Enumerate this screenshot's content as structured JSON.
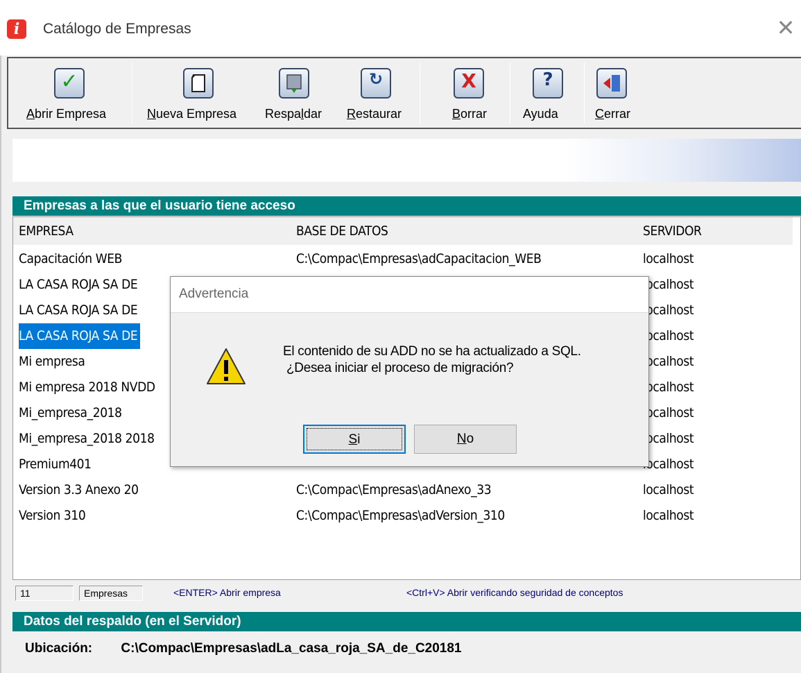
{
  "window": {
    "title": "Catálogo de Empresas",
    "close_glyph": "✕"
  },
  "toolbar": {
    "buttons": [
      {
        "key": "A",
        "rest": "brir Empresa",
        "icon": "checkmark-icon"
      },
      {
        "key": "N",
        "rest": "ueva Empresa",
        "icon": "new-document-icon"
      },
      {
        "pre": "Respa",
        "key": "l",
        "rest": "dar",
        "icon": "backup-icon"
      },
      {
        "key": "R",
        "rest": "estaurar",
        "icon": "restore-icon"
      },
      {
        "key": "B",
        "rest": "orrar",
        "icon": "delete-icon"
      },
      {
        "pre": "Ayuda",
        "icon": "help-icon"
      },
      {
        "key": "C",
        "rest": "errar",
        "icon": "exit-icon"
      }
    ]
  },
  "companies_section": {
    "header": "Empresas a las que el usuario tiene acceso"
  },
  "list": {
    "columns": [
      "EMPRESA",
      "BASE DE DATOS",
      "SERVIDOR"
    ],
    "rows": [
      {
        "empresa": "Capacitación WEB",
        "base": "C:\\Compac\\Empresas\\adCapacitacion_WEB",
        "servidor": "localhost"
      },
      {
        "empresa": "LA CASA ROJA SA DE",
        "base": "",
        "servidor": "localhost"
      },
      {
        "empresa": "LA CASA ROJA SA DE",
        "base": "",
        "servidor": "localhost"
      },
      {
        "empresa": "LA CASA ROJA SA DE",
        "base": "",
        "servidor": "localhost",
        "selected": true
      },
      {
        "empresa": "Mi empresa",
        "base": "",
        "servidor": "localhost"
      },
      {
        "empresa": "Mi empresa 2018 NVDD",
        "base": "",
        "servidor": "localhost"
      },
      {
        "empresa": "Mi_empresa_2018",
        "base": "",
        "servidor": "localhost"
      },
      {
        "empresa": "Mi_empresa_2018 2018",
        "base": "",
        "servidor": "localhost"
      },
      {
        "empresa": "Premium401",
        "base": "",
        "servidor": "localhost"
      },
      {
        "empresa": "Version 3.3 Anexo 20",
        "base": "C:\\Compac\\Empresas\\adAnexo_33",
        "servidor": "localhost"
      },
      {
        "empresa": "Version 310",
        "base": "C:\\Compac\\Empresas\\adVersion_310",
        "servidor": "localhost"
      }
    ]
  },
  "status": {
    "count": "11",
    "count_label": "Empresas",
    "hint_enter": "<ENTER> Abrir empresa",
    "hint_ctrlv": "<Ctrl+V>  Abrir verificando seguridad de conceptos"
  },
  "backup_section": {
    "header": "Datos del respaldo (en el Servidor)",
    "location_label": "Ubicación:",
    "location_value": "C:\\Compac\\Empresas\\adLa_casa_roja_SA_de_C20181"
  },
  "dialog": {
    "title": "Advertencia",
    "message": "El contenido de su ADD no se ha actualizado a SQL.\n ¿Desea iniciar el proceso de migración?",
    "yes": {
      "key": "S",
      "rest": "i"
    },
    "no": {
      "key": "N",
      "rest": "o"
    },
    "icon": "warning-icon"
  }
}
